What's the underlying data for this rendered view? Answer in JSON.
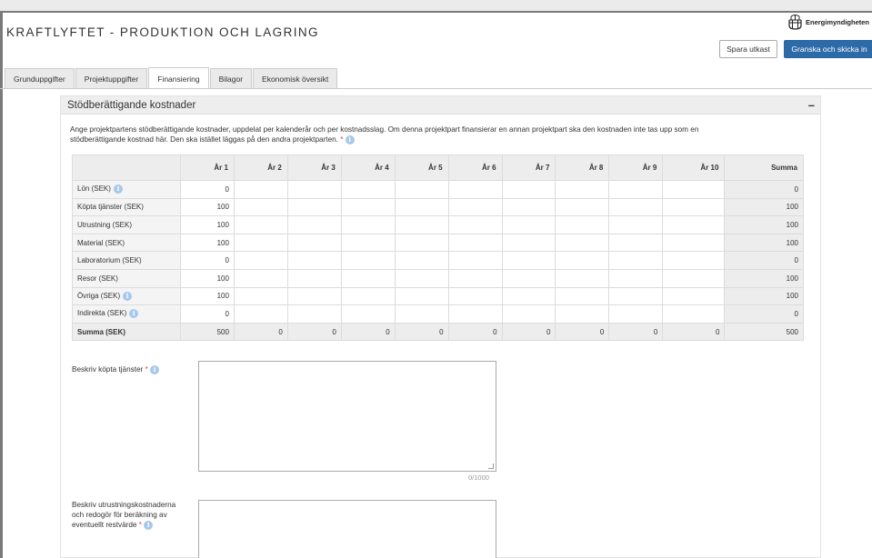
{
  "app": {
    "title": "KRAFTLYFTET - PRODUKTION OCH LAGRING",
    "logo_text": "Energimyndigheten",
    "buttons": {
      "draft": "Spara utkast",
      "submit": "Granska och skicka in"
    }
  },
  "tabs": [
    {
      "label": "Grunduppgifter",
      "active": false
    },
    {
      "label": "Projektuppgifter",
      "active": false
    },
    {
      "label": "Finansiering",
      "active": true
    },
    {
      "label": "Bilagor",
      "active": false
    },
    {
      "label": "Ekonomisk översikt",
      "active": false
    }
  ],
  "panel": {
    "title": "Stödberättigande kostnader",
    "collapse": "–",
    "description": "Ange projektpartens stödberättigande kostnader, uppdelat per kalenderår och per kostnadsslag. Om denna projektpart finansierar en annan projektpart ska den kostnaden inte tas upp som en stödberättigande kostnad här. Den ska istället läggas på den andra projektparten.",
    "required_mark": "*"
  },
  "table": {
    "headers": [
      "",
      "År 1",
      "År 2",
      "År 3",
      "År 4",
      "År 5",
      "År 6",
      "År 7",
      "År 8",
      "År 9",
      "År 10",
      "Summa"
    ],
    "rows": [
      {
        "label": "Lön (SEK)",
        "info": true,
        "values": [
          "0",
          "",
          "",
          "",
          "",
          "",
          "",
          "",
          "",
          ""
        ],
        "sum": "0"
      },
      {
        "label": "Köpta tjänster (SEK)",
        "info": false,
        "values": [
          "100",
          "",
          "",
          "",
          "",
          "",
          "",
          "",
          "",
          ""
        ],
        "sum": "100"
      },
      {
        "label": "Utrustning (SEK)",
        "info": false,
        "values": [
          "100",
          "",
          "",
          "",
          "",
          "",
          "",
          "",
          "",
          ""
        ],
        "sum": "100"
      },
      {
        "label": "Material (SEK)",
        "info": false,
        "values": [
          "100",
          "",
          "",
          "",
          "",
          "",
          "",
          "",
          "",
          ""
        ],
        "sum": "100"
      },
      {
        "label": "Laboratorium (SEK)",
        "info": false,
        "values": [
          "0",
          "",
          "",
          "",
          "",
          "",
          "",
          "",
          "",
          ""
        ],
        "sum": "0"
      },
      {
        "label": "Resor (SEK)",
        "info": false,
        "values": [
          "100",
          "",
          "",
          "",
          "",
          "",
          "",
          "",
          "",
          ""
        ],
        "sum": "100"
      },
      {
        "label": "Övriga (SEK)",
        "info": true,
        "values": [
          "100",
          "",
          "",
          "",
          "",
          "",
          "",
          "",
          "",
          ""
        ],
        "sum": "100"
      },
      {
        "label": "Indirekta (SEK)",
        "info": true,
        "values": [
          "0",
          "",
          "",
          "",
          "",
          "",
          "",
          "",
          "",
          ""
        ],
        "sum": "0"
      }
    ],
    "total": {
      "label": "Summa (SEK)",
      "values": [
        "500",
        "0",
        "0",
        "0",
        "0",
        "0",
        "0",
        "0",
        "0",
        "0"
      ],
      "sum": "500"
    }
  },
  "fields": {
    "kopta": {
      "label": "Beskriv köpta tjänster",
      "value": "",
      "counter": "0/1000"
    },
    "utrustning": {
      "label": "Beskriv utrustningskostnaderna och redogör för beräkning av eventuellt restvärde",
      "value": ""
    }
  },
  "icons": {
    "info": "info-icon",
    "logo": "crown-logo-icon",
    "collapse": "minus-icon"
  },
  "colors": {
    "primary": "#2d6ba8",
    "required": "#e04040",
    "info": "#a8c8ea"
  }
}
